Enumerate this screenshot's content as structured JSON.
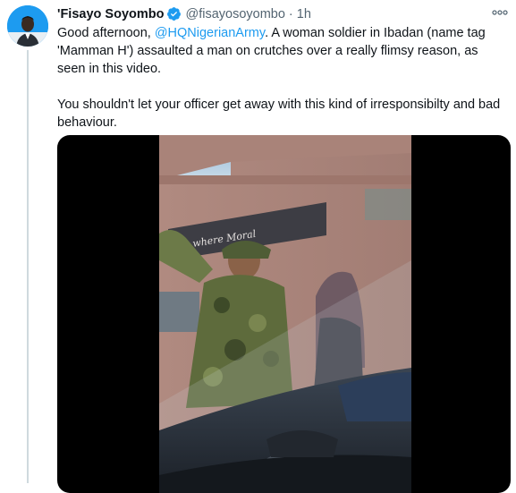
{
  "author": {
    "name": "'Fisayo Soyombo",
    "handle": "@fisayosoyombo",
    "time": "1h",
    "separator": "·",
    "verified": true
  },
  "tweet": {
    "line1_pre": "Good afternoon, ",
    "mention": "@HQNigerianArmy",
    "line1_post": ". A woman soldier in Ibadan (name tag 'Mamman H') assaulted a man on crutches over a really flimsy reason, as seen in this video.",
    "paragraph2": "You shouldn't let your officer get away with this kind of irresponsibilty and bad behaviour."
  },
  "media": {
    "type": "video",
    "sign_text": "...y where Moral"
  },
  "icons": {
    "more": "more-horizontal-icon",
    "verified": "verified-badge-icon"
  },
  "colors": {
    "accent": "#1d9bf0",
    "secondary_text": "#536471",
    "thread_line": "#cfd9de"
  }
}
